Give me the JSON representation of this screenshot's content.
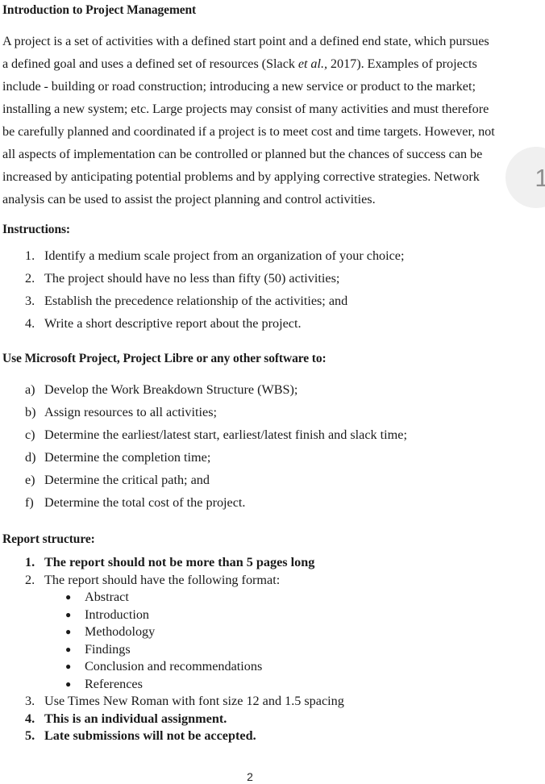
{
  "document": {
    "title": "Introduction to Project Management",
    "footer_page_number": "2"
  },
  "overlay": {
    "page_indicator_number": "1",
    "background_color": "#f0f0f0",
    "text_color": "#8f8f8f"
  },
  "intro_paragraph": {
    "part_1": "A project is a set of activities with a defined start point and a defined end state, which pursues a defined goal and uses a defined set of resources (Slack ",
    "citation_italic": "et al.,",
    "part_2": " 2017). Examples of projects include - building or road construction; introducing a new service or product to the market; installing a new system; etc. Large projects may consist of many activities and must therefore be carefully planned and coordinated if a project is to meet cost and time targets. However, not all aspects of implementation can be controlled or planned but the chances of success can be increased by anticipating potential problems and by applying corrective strategies. Network analysis can be used to assist the project planning and control activities."
  },
  "instructions": {
    "heading": "Instructions:",
    "items": [
      {
        "marker": "1.",
        "text": "Identify a medium scale project from an organization of your choice;"
      },
      {
        "marker": "2.",
        "text": "The project should have no less than fifty (50) activities;"
      },
      {
        "marker": "3.",
        "text": "Establish the precedence relationship of the activities; and"
      },
      {
        "marker": "4.",
        "text": "Write a short descriptive report about the project."
      }
    ]
  },
  "software_tasks": {
    "heading": "Use Microsoft Project, Project Libre or any other software to:",
    "items": [
      {
        "marker": "a)",
        "text": "Develop the Work Breakdown Structure (WBS);"
      },
      {
        "marker": "b)",
        "text": "Assign resources to all activities;"
      },
      {
        "marker": "c)",
        "text": "Determine the earliest/latest start, earliest/latest finish and slack time;"
      },
      {
        "marker": "d)",
        "text": "Determine the completion time;"
      },
      {
        "marker": "e)",
        "text": "Determine the critical path; and"
      },
      {
        "marker": "f)",
        "text": "Determine the total cost of the project."
      }
    ]
  },
  "report_structure": {
    "heading": "Report structure:",
    "items": [
      {
        "marker": "1.",
        "text": "The report should not be more than 5 pages long",
        "bold": true
      },
      {
        "marker": "2.",
        "text": "The report should have the following format:",
        "bold": false
      },
      {
        "marker": "3.",
        "text": "Use Times New Roman with font size 12 and 1.5 spacing",
        "bold": false
      },
      {
        "marker": "4.",
        "text": "This is an individual assignment.",
        "bold": true
      },
      {
        "marker": "5.",
        "text": "Late submissions will not be accepted.",
        "bold": true
      }
    ],
    "format_bullets": [
      {
        "bullet_glyph": "●",
        "text": "Abstract"
      },
      {
        "bullet_glyph": "●",
        "text": "Introduction"
      },
      {
        "bullet_glyph": "●",
        "text": "Methodology"
      },
      {
        "bullet_glyph": "●",
        "text": "Findings"
      },
      {
        "bullet_glyph": "●",
        "text": "Conclusion and recommendations"
      },
      {
        "bullet_glyph": "●",
        "text": "References"
      }
    ]
  }
}
